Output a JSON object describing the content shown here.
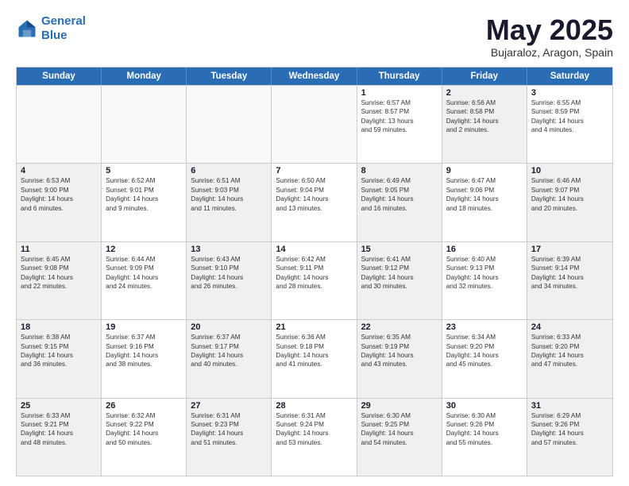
{
  "logo": {
    "line1": "General",
    "line2": "Blue"
  },
  "title": "May 2025",
  "subtitle": "Bujaraloz, Aragon, Spain",
  "header_days": [
    "Sunday",
    "Monday",
    "Tuesday",
    "Wednesday",
    "Thursday",
    "Friday",
    "Saturday"
  ],
  "weeks": [
    [
      {
        "day": "",
        "info": [],
        "empty": true
      },
      {
        "day": "",
        "info": [],
        "empty": true
      },
      {
        "day": "",
        "info": [],
        "empty": true
      },
      {
        "day": "",
        "info": [],
        "empty": true
      },
      {
        "day": "1",
        "info": [
          "Sunrise: 6:57 AM",
          "Sunset: 8:57 PM",
          "Daylight: 13 hours",
          "and 59 minutes."
        ],
        "empty": false
      },
      {
        "day": "2",
        "info": [
          "Sunrise: 6:56 AM",
          "Sunset: 8:58 PM",
          "Daylight: 14 hours",
          "and 2 minutes."
        ],
        "empty": false,
        "shaded": true
      },
      {
        "day": "3",
        "info": [
          "Sunrise: 6:55 AM",
          "Sunset: 8:59 PM",
          "Daylight: 14 hours",
          "and 4 minutes."
        ],
        "empty": false
      }
    ],
    [
      {
        "day": "4",
        "info": [
          "Sunrise: 6:53 AM",
          "Sunset: 9:00 PM",
          "Daylight: 14 hours",
          "and 6 minutes."
        ],
        "empty": false,
        "shaded": true
      },
      {
        "day": "5",
        "info": [
          "Sunrise: 6:52 AM",
          "Sunset: 9:01 PM",
          "Daylight: 14 hours",
          "and 9 minutes."
        ],
        "empty": false
      },
      {
        "day": "6",
        "info": [
          "Sunrise: 6:51 AM",
          "Sunset: 9:03 PM",
          "Daylight: 14 hours",
          "and 11 minutes."
        ],
        "empty": false,
        "shaded": true
      },
      {
        "day": "7",
        "info": [
          "Sunrise: 6:50 AM",
          "Sunset: 9:04 PM",
          "Daylight: 14 hours",
          "and 13 minutes."
        ],
        "empty": false
      },
      {
        "day": "8",
        "info": [
          "Sunrise: 6:49 AM",
          "Sunset: 9:05 PM",
          "Daylight: 14 hours",
          "and 16 minutes."
        ],
        "empty": false,
        "shaded": true
      },
      {
        "day": "9",
        "info": [
          "Sunrise: 6:47 AM",
          "Sunset: 9:06 PM",
          "Daylight: 14 hours",
          "and 18 minutes."
        ],
        "empty": false
      },
      {
        "day": "10",
        "info": [
          "Sunrise: 6:46 AM",
          "Sunset: 9:07 PM",
          "Daylight: 14 hours",
          "and 20 minutes."
        ],
        "empty": false,
        "shaded": true
      }
    ],
    [
      {
        "day": "11",
        "info": [
          "Sunrise: 6:45 AM",
          "Sunset: 9:08 PM",
          "Daylight: 14 hours",
          "and 22 minutes."
        ],
        "empty": false,
        "shaded": true
      },
      {
        "day": "12",
        "info": [
          "Sunrise: 6:44 AM",
          "Sunset: 9:09 PM",
          "Daylight: 14 hours",
          "and 24 minutes."
        ],
        "empty": false
      },
      {
        "day": "13",
        "info": [
          "Sunrise: 6:43 AM",
          "Sunset: 9:10 PM",
          "Daylight: 14 hours",
          "and 26 minutes."
        ],
        "empty": false,
        "shaded": true
      },
      {
        "day": "14",
        "info": [
          "Sunrise: 6:42 AM",
          "Sunset: 9:11 PM",
          "Daylight: 14 hours",
          "and 28 minutes."
        ],
        "empty": false
      },
      {
        "day": "15",
        "info": [
          "Sunrise: 6:41 AM",
          "Sunset: 9:12 PM",
          "Daylight: 14 hours",
          "and 30 minutes."
        ],
        "empty": false,
        "shaded": true
      },
      {
        "day": "16",
        "info": [
          "Sunrise: 6:40 AM",
          "Sunset: 9:13 PM",
          "Daylight: 14 hours",
          "and 32 minutes."
        ],
        "empty": false
      },
      {
        "day": "17",
        "info": [
          "Sunrise: 6:39 AM",
          "Sunset: 9:14 PM",
          "Daylight: 14 hours",
          "and 34 minutes."
        ],
        "empty": false,
        "shaded": true
      }
    ],
    [
      {
        "day": "18",
        "info": [
          "Sunrise: 6:38 AM",
          "Sunset: 9:15 PM",
          "Daylight: 14 hours",
          "and 36 minutes."
        ],
        "empty": false,
        "shaded": true
      },
      {
        "day": "19",
        "info": [
          "Sunrise: 6:37 AM",
          "Sunset: 9:16 PM",
          "Daylight: 14 hours",
          "and 38 minutes."
        ],
        "empty": false
      },
      {
        "day": "20",
        "info": [
          "Sunrise: 6:37 AM",
          "Sunset: 9:17 PM",
          "Daylight: 14 hours",
          "and 40 minutes."
        ],
        "empty": false,
        "shaded": true
      },
      {
        "day": "21",
        "info": [
          "Sunrise: 6:36 AM",
          "Sunset: 9:18 PM",
          "Daylight: 14 hours",
          "and 41 minutes."
        ],
        "empty": false
      },
      {
        "day": "22",
        "info": [
          "Sunrise: 6:35 AM",
          "Sunset: 9:19 PM",
          "Daylight: 14 hours",
          "and 43 minutes."
        ],
        "empty": false,
        "shaded": true
      },
      {
        "day": "23",
        "info": [
          "Sunrise: 6:34 AM",
          "Sunset: 9:20 PM",
          "Daylight: 14 hours",
          "and 45 minutes."
        ],
        "empty": false
      },
      {
        "day": "24",
        "info": [
          "Sunrise: 6:33 AM",
          "Sunset: 9:20 PM",
          "Daylight: 14 hours",
          "and 47 minutes."
        ],
        "empty": false,
        "shaded": true
      }
    ],
    [
      {
        "day": "25",
        "info": [
          "Sunrise: 6:33 AM",
          "Sunset: 9:21 PM",
          "Daylight: 14 hours",
          "and 48 minutes."
        ],
        "empty": false,
        "shaded": true
      },
      {
        "day": "26",
        "info": [
          "Sunrise: 6:32 AM",
          "Sunset: 9:22 PM",
          "Daylight: 14 hours",
          "and 50 minutes."
        ],
        "empty": false
      },
      {
        "day": "27",
        "info": [
          "Sunrise: 6:31 AM",
          "Sunset: 9:23 PM",
          "Daylight: 14 hours",
          "and 51 minutes."
        ],
        "empty": false,
        "shaded": true
      },
      {
        "day": "28",
        "info": [
          "Sunrise: 6:31 AM",
          "Sunset: 9:24 PM",
          "Daylight: 14 hours",
          "and 53 minutes."
        ],
        "empty": false
      },
      {
        "day": "29",
        "info": [
          "Sunrise: 6:30 AM",
          "Sunset: 9:25 PM",
          "Daylight: 14 hours",
          "and 54 minutes."
        ],
        "empty": false,
        "shaded": true
      },
      {
        "day": "30",
        "info": [
          "Sunrise: 6:30 AM",
          "Sunset: 9:26 PM",
          "Daylight: 14 hours",
          "and 55 minutes."
        ],
        "empty": false
      },
      {
        "day": "31",
        "info": [
          "Sunrise: 6:29 AM",
          "Sunset: 9:26 PM",
          "Daylight: 14 hours",
          "and 57 minutes."
        ],
        "empty": false,
        "shaded": true
      }
    ]
  ]
}
